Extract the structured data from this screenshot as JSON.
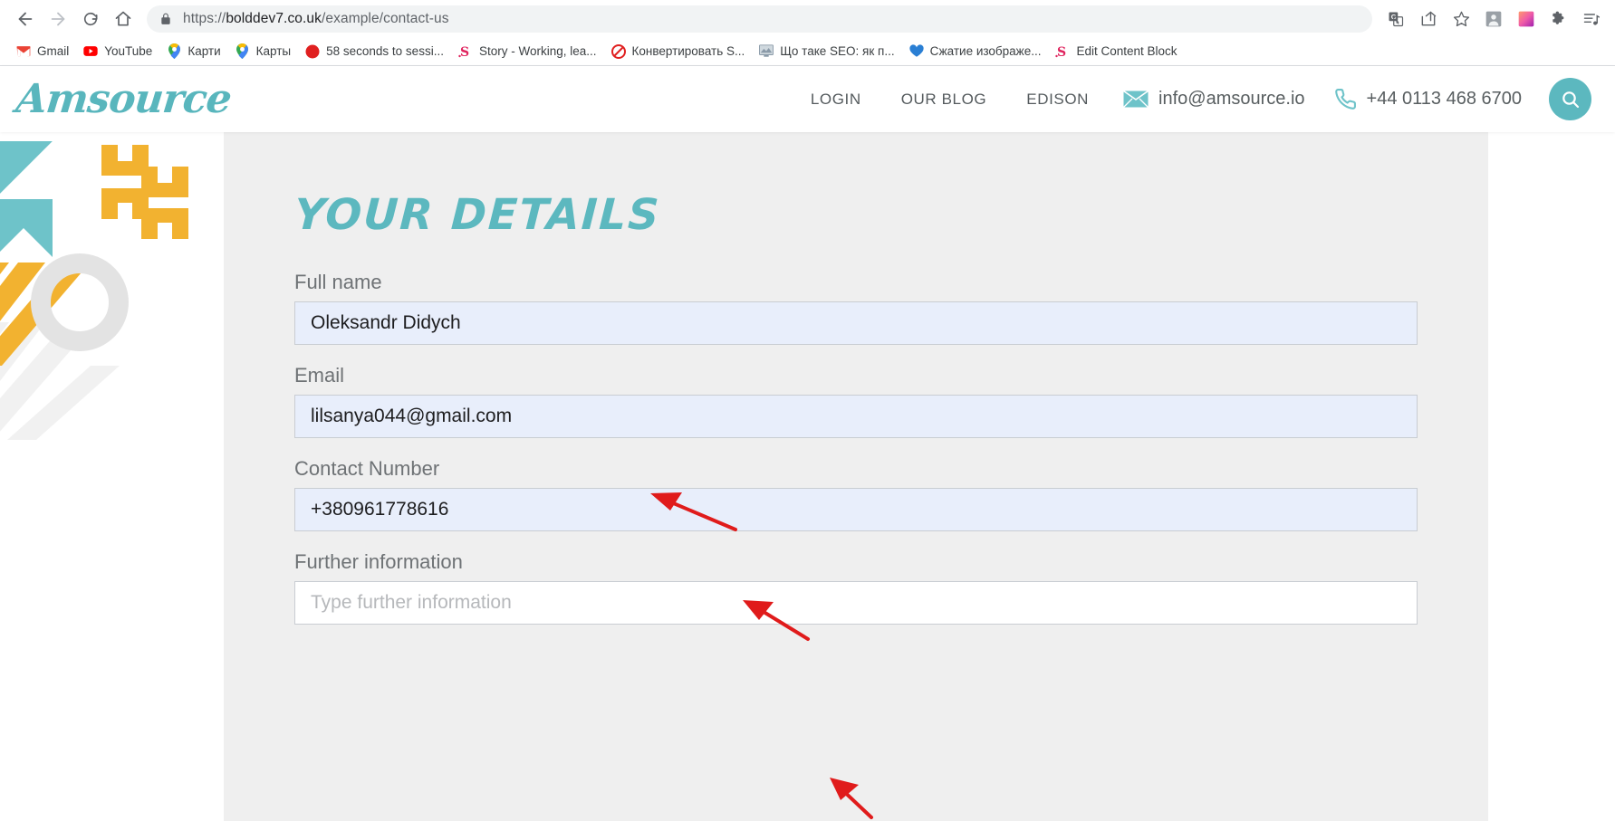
{
  "browser": {
    "back_label": "Back",
    "forward_label": "Forward",
    "reload_label": "Reload",
    "home_label": "Home",
    "url_scheme": "https://",
    "url_host": "bolddev7.co.uk",
    "url_path": "/example/contact-us",
    "url_full": "https://bolddev7.co.uk/example/contact-us",
    "secure_icon": "lock-icon",
    "toolbar_icons": [
      {
        "name": "translate-icon",
        "label": "Translate"
      },
      {
        "name": "share-icon",
        "label": "Share"
      },
      {
        "name": "bookmark-star-icon",
        "label": "Bookmark this tab"
      },
      {
        "name": "extension-profile-icon",
        "label": "Extension"
      },
      {
        "name": "gradient-extension-icon",
        "label": "Extension"
      },
      {
        "name": "puzzle-extensions-icon",
        "label": "Extensions"
      },
      {
        "name": "playlist-icon",
        "label": "Reading list"
      }
    ],
    "bookmarks": [
      {
        "label": "Gmail",
        "icon": "gmail-icon",
        "color": "#ea4335"
      },
      {
        "label": "YouTube",
        "icon": "youtube-icon",
        "color": "#ff0000"
      },
      {
        "label": "Карти",
        "icon": "google-maps-icon",
        "color": "#34a853"
      },
      {
        "label": "Карты",
        "icon": "google-maps-icon",
        "color": "#34a853"
      },
      {
        "label": "58 seconds to sessi...",
        "icon": "red-dot-icon",
        "color": "#e02020"
      },
      {
        "label": "Story - Working, lea...",
        "icon": "s-letter-icon",
        "color": "#e0245e"
      },
      {
        "label": "Конвертировать S...",
        "icon": "no-entry-icon",
        "color": "#e02020"
      },
      {
        "label": "Що таке SEO: як п...",
        "icon": "monitor-icon",
        "color": "#8a9aa8"
      },
      {
        "label": "Сжатие изображе...",
        "icon": "blue-heart-icon",
        "color": "#2a7fd4"
      },
      {
        "label": "Edit Content Block",
        "icon": "s-letter-icon",
        "color": "#e0245e"
      }
    ]
  },
  "site": {
    "logo_text": "Amsource",
    "brand_teal": "#5cb8bf",
    "brand_yellow": "#f2b230",
    "nav_links": [
      {
        "label": "LOGIN"
      },
      {
        "label": "OUR BLOG"
      },
      {
        "label": "EDISON"
      }
    ],
    "email": "info@amsource.io",
    "email_icon": "envelope-icon",
    "phone": "+44 0113 468 6700",
    "phone_icon": "phone-icon",
    "search_icon": "search-icon"
  },
  "form": {
    "title": "YOUR DETAILS",
    "fields": [
      {
        "label": "Full name",
        "value": "Oleksandr Didych",
        "placeholder": "",
        "name": "full-name-input",
        "autofilled": true
      },
      {
        "label": "Email",
        "value": "lilsanya044@gmail.com",
        "placeholder": "",
        "name": "email-input",
        "autofilled": true
      },
      {
        "label": "Contact Number",
        "value": "+380961778616",
        "placeholder": "",
        "name": "contact-number-input",
        "autofilled": true
      },
      {
        "label": "Further information",
        "value": "",
        "placeholder": "Type further information",
        "name": "further-information-input",
        "autofilled": false
      }
    ]
  },
  "annotations": {
    "arrow_color": "#e01b1b",
    "arrows": [
      {
        "name": "arrow-to-full-name"
      },
      {
        "name": "arrow-to-email"
      },
      {
        "name": "arrow-to-contact-number"
      }
    ]
  }
}
